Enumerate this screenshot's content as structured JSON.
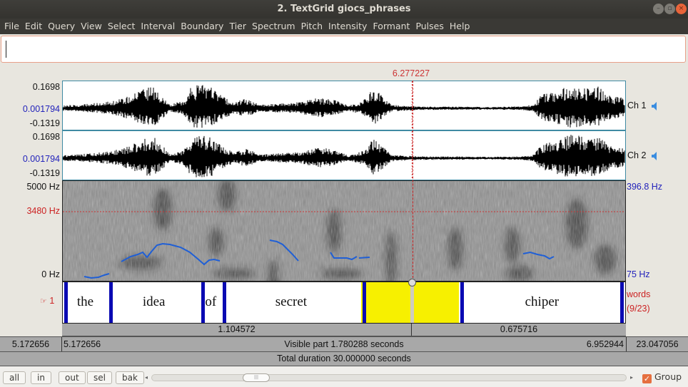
{
  "window": {
    "title": "2. TextGrid giocs_phrases",
    "controls": [
      "minimize",
      "maximize",
      "close"
    ]
  },
  "menu": [
    "File",
    "Edit",
    "Query",
    "View",
    "Select",
    "Interval",
    "Boundary",
    "Tier",
    "Spectrum",
    "Pitch",
    "Intensity",
    "Formant",
    "Pulses",
    "Help"
  ],
  "text_field": {
    "value": ""
  },
  "cursor": {
    "time": "6.277227",
    "fraction_of_view": 0.621
  },
  "channels": [
    {
      "name": "Ch 1",
      "max": "0.1698",
      "zero": "0.001794",
      "min": "-0.1319",
      "icon": "speaker-icon"
    },
    {
      "name": "Ch 2",
      "max": "0.1698",
      "zero": "0.001794",
      "min": "-0.1319",
      "icon": "speaker-icon"
    }
  ],
  "spectrogram": {
    "top_freq": "5000 Hz",
    "cursor_freq": "3480 Hz",
    "bottom_freq": "0 Hz",
    "pitch_top": "396.8 Hz",
    "pitch_bottom": "75 Hz"
  },
  "tier": {
    "number": "1",
    "pointer_icon": "hand-pointer-icon",
    "name": "words",
    "count": "(9/23)",
    "intervals": [
      {
        "label": "the",
        "start": 0.0,
        "end": 0.08,
        "selected": false
      },
      {
        "label": "idea",
        "start": 0.08,
        "end": 0.244,
        "selected": false
      },
      {
        "label": "of",
        "start": 0.244,
        "end": 0.282,
        "selected": false
      },
      {
        "label": "secret",
        "start": 0.282,
        "end": 0.53,
        "selected": false
      },
      {
        "label": "",
        "start": 0.53,
        "end": 0.704,
        "selected": true
      },
      {
        "label": "chiper",
        "start": 0.704,
        "end": 1.0,
        "selected": false
      }
    ]
  },
  "durations": {
    "left": "1.104572",
    "right": "0.675716"
  },
  "visible": {
    "outer_left": "5.172656",
    "left": "5.172656",
    "label": "Visible part 1.780288 seconds",
    "right": "6.952944",
    "outer_right": "23.047056"
  },
  "total": {
    "label": "Total duration 30.000000 seconds"
  },
  "bottom": {
    "buttons": [
      "all",
      "in",
      "out",
      "sel",
      "bak"
    ],
    "scroll_position": 0.2,
    "group_label": "Group",
    "group_checked": true
  },
  "colors": {
    "boundary": "#0a0ab3",
    "selection": "#f7f000",
    "pitch": "#1f5fd6",
    "cursor": "#cc2222",
    "axis_blue": "#2222bb"
  }
}
